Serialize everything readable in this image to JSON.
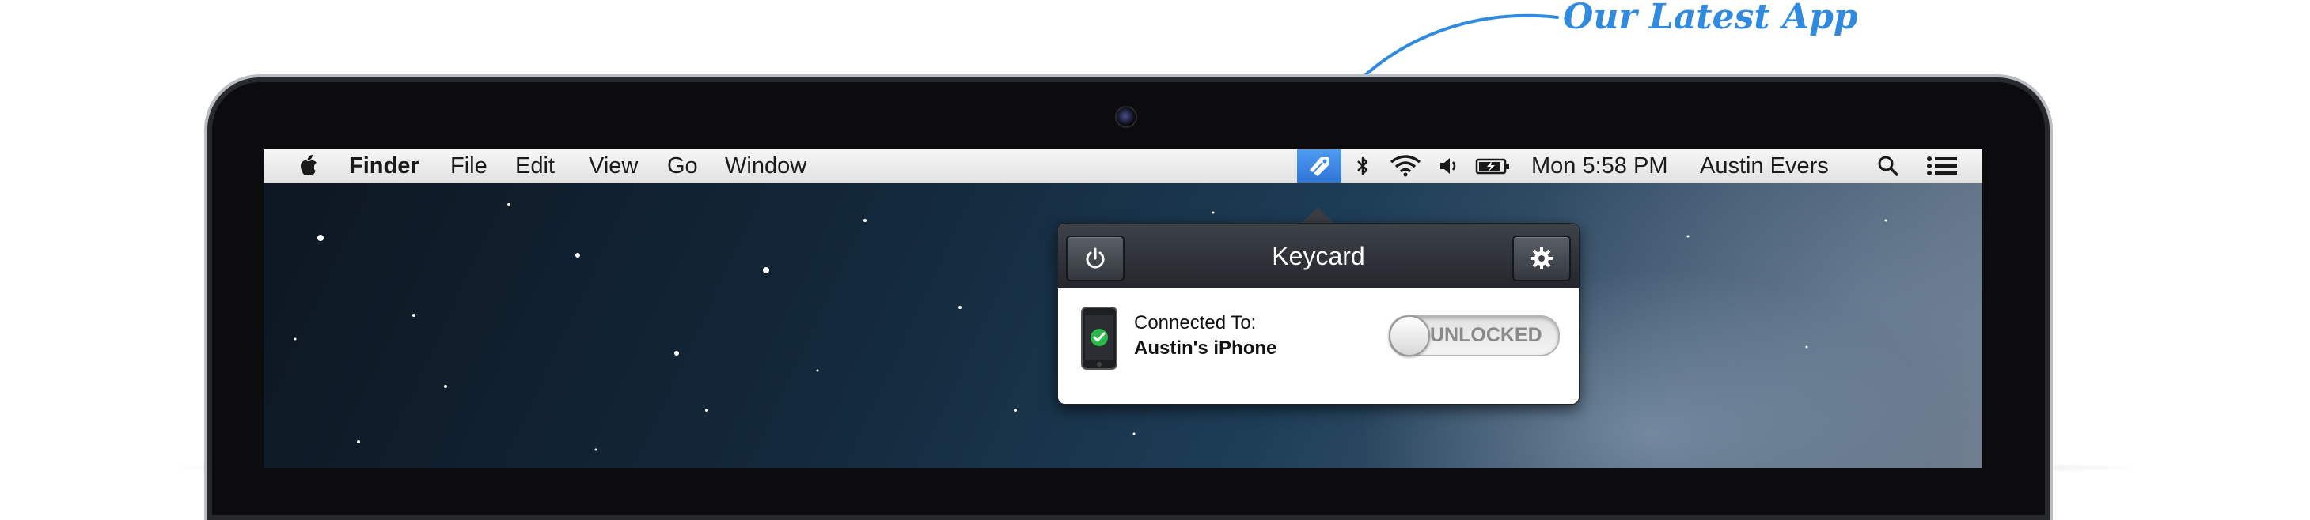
{
  "callout": {
    "text": "Our Latest App",
    "color": "#2f8ae0"
  },
  "menubar": {
    "apple_icon": "apple-logo-icon",
    "app_name": "Finder",
    "menus": [
      "File",
      "Edit",
      "View",
      "Go",
      "Window"
    ],
    "status_icons": [
      "keycard-tag-icon",
      "bluetooth-icon",
      "wifi-icon",
      "volume-icon",
      "battery-icon"
    ],
    "clock": "Mon 5:58 PM",
    "user": "Austin Evers",
    "right_icons": [
      "spotlight-search-icon",
      "notification-center-icon"
    ]
  },
  "popover": {
    "title": "Keycard",
    "power_icon": "power-icon",
    "settings_icon": "gear-icon",
    "connected_label": "Connected To:",
    "device_name": "Austin's iPhone",
    "device_icon": "iphone-check-icon",
    "toggle_label": "UNLOCKED",
    "status_color": "#2db84a"
  },
  "colors": {
    "accent": "#2f8ae0",
    "highlight": "#3d86e6"
  }
}
